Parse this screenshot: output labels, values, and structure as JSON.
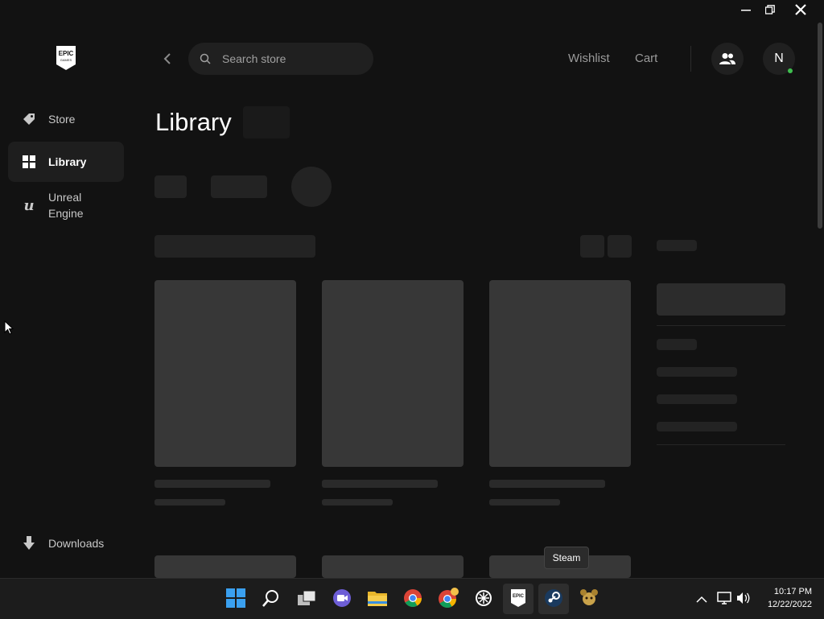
{
  "window": {
    "controls": [
      "minimize",
      "restore",
      "close"
    ]
  },
  "sidebar": {
    "logo_text_top": "EPIC",
    "logo_text_bottom": "GAMES",
    "items": [
      {
        "label": "Store",
        "icon": "tag-icon",
        "active": false
      },
      {
        "label": "Library",
        "icon": "grid-icon",
        "active": true
      },
      {
        "label_line1": "Unreal",
        "label_line2": "Engine",
        "icon": "unreal-icon",
        "active": false
      }
    ],
    "downloads_label": "Downloads"
  },
  "header": {
    "search_placeholder": "Search store",
    "wishlist_label": "Wishlist",
    "cart_label": "Cart",
    "avatar_initial": "N",
    "online_color": "#3fbf4f"
  },
  "main": {
    "title": "Library"
  },
  "tooltip": {
    "text": "Steam"
  },
  "taskbar": {
    "apps": [
      "windows-start-icon",
      "search-icon",
      "task-view-icon",
      "chat-icon",
      "file-explorer-icon",
      "chrome-icon",
      "chrome-profile-icon",
      "app-icon",
      "epic-games-icon",
      "steam-icon",
      "game-icon"
    ],
    "time": "10:17 PM",
    "date": "12/22/2022"
  },
  "colors": {
    "background": "#121212",
    "accent_green": "#3fbf4f"
  }
}
